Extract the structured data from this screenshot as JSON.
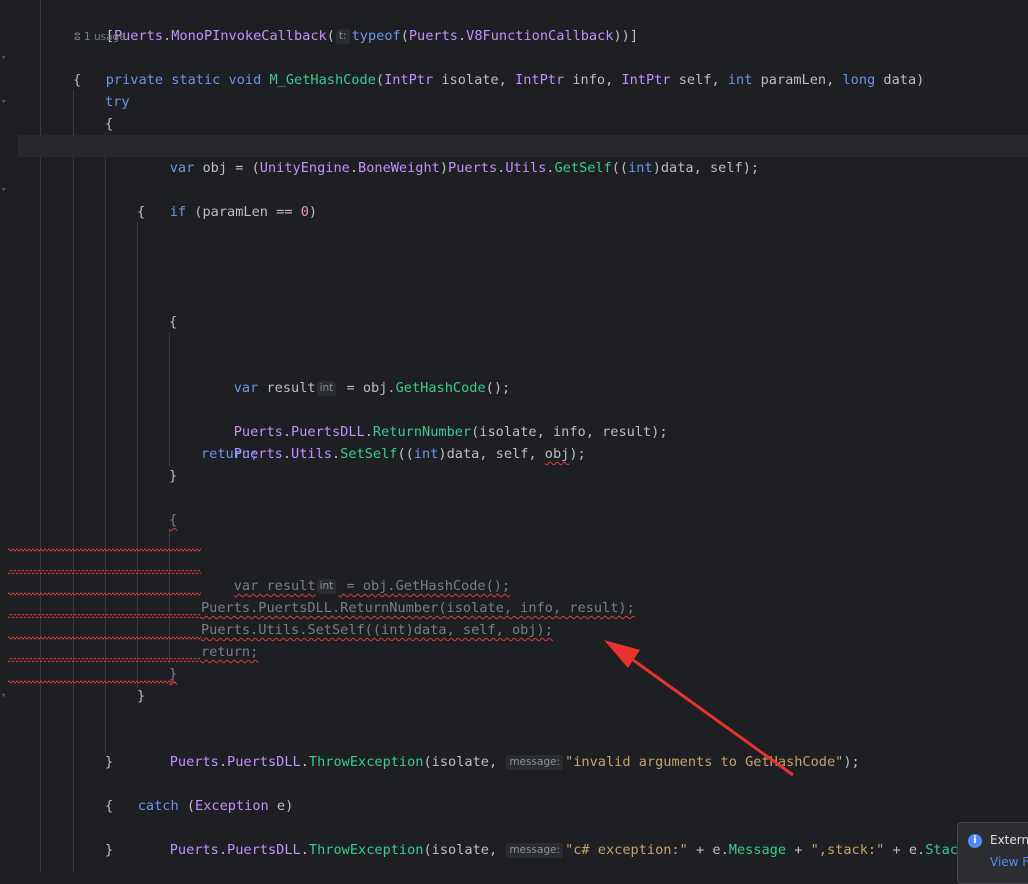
{
  "editor": {
    "usage_hint": "1 usage",
    "lines": {
      "attr": {
        "open": "[",
        "ns": "Puerts",
        "dot": ".",
        "name": "MonoPInvokeCallback",
        "paren": "(",
        "hint": "t:",
        "typeof": "typeof",
        "paren2": "(",
        "ns2": "Puerts",
        "dot2": ".",
        "type2": "V8FunctionCallback",
        "close": "))]"
      },
      "sig": {
        "private": "private",
        "static": "static",
        "void": "void",
        "name": "M_GetHashCode",
        "p1type": "IntPtr",
        "p1": "isolate,",
        "p2type": "IntPtr",
        "p2": "info,",
        "p3type": "IntPtr",
        "p3": "self,",
        "p4type": "int",
        "p4": "paramLen,",
        "p5type": "long",
        "p5": "data)",
        "open": "("
      },
      "brace_open_1": "{",
      "try": "try",
      "brace_open_2": "{",
      "var_obj": {
        "var": "var",
        "rest1": " obj = (",
        "ns": "UnityEngine",
        "dot": ".",
        "type": "BoneWeight",
        "close": ")",
        "ns2": "Puerts",
        "dot2": ".",
        "type2": "Utils",
        "dot3": ".",
        "method": "GetSelf",
        "rest2": "((",
        "int": "int",
        "rest3": ")data, self);"
      },
      "if_line": {
        "if": "if",
        "rest1": " (paramLen == ",
        "num": "0",
        "rest2": ")"
      },
      "brace_open_3": "{",
      "brace_open_4": "{",
      "result1": {
        "var": "var",
        "name": " result",
        "hint": "int",
        "rest": " = obj.",
        "method": "GetHashCode",
        "end": "();"
      },
      "ret_num1": {
        "ns": "Puerts",
        "dot": ".",
        "type": "PuertsDLL",
        "dot2": ".",
        "method": "ReturnNumber",
        "rest": "(isolate, info, result);"
      },
      "setself1": {
        "ns": "Puerts",
        "dot": ".",
        "type": "Utils",
        "dot2": ".",
        "method": "SetSelf",
        "rest1": "((",
        "int": "int",
        "rest2": ")data, self, ",
        "obj": "obj",
        "rest3": ");"
      },
      "return1": "return;",
      "brace_close_4": "}",
      "brace_open_5": "{",
      "result2": {
        "text1": "var result",
        "hint": "int",
        "text2": " = obj.GetHashCode();"
      },
      "ret_num2": "Puerts.PuertsDLL.ReturnNumber(isolate, info, result);",
      "setself2": "Puerts.Utils.SetSelf((int)data, self, obj);",
      "return2": "return;",
      "brace_close_5": "}",
      "brace_close_3": "}",
      "throw1": {
        "ns": "Puerts",
        "dot": ".",
        "type": "PuertsDLL",
        "dot2": ".",
        "method": "ThrowException",
        "rest": "(isolate, ",
        "hint": "message:",
        "str": "\"invalid arguments to GetHashCode\"",
        "end": ");"
      },
      "brace_close_2": "}",
      "catch": {
        "catch": "catch",
        "rest1": " (",
        "type": "Exception",
        "rest2": " e)"
      },
      "brace_open_6": "{",
      "throw2": {
        "ns": "Puerts",
        "dot": ".",
        "type": "PuertsDLL",
        "dot2": ".",
        "method": "ThrowException",
        "rest": "(isolate, ",
        "hint": "message:",
        "str1": "\"c# exception:\"",
        "plus1": " + ",
        "e1": "e.",
        "msg": "Message",
        "plus2": " + ",
        "str2": "\",stack:\"",
        "plus3": " + e.",
        "stack": "StackTrace"
      },
      "brace_close_6": "}"
    }
  },
  "notification": {
    "title": "Externa",
    "link": "View Fi"
  },
  "annotation": {
    "color": "#e8322f"
  }
}
